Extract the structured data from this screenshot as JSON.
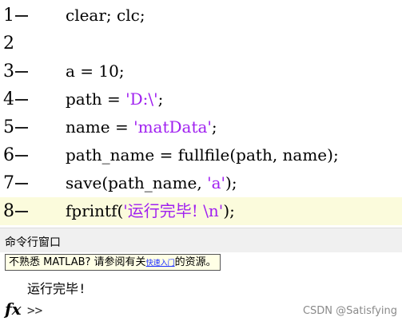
{
  "editor": {
    "lines": [
      {
        "number": "1",
        "code": "clear; clc;",
        "parts": [
          {
            "t": "clear; clc;",
            "s": false
          }
        ]
      },
      {
        "number": "2",
        "code": "",
        "parts": []
      },
      {
        "number": "3",
        "code": "a = 10;",
        "parts": [
          {
            "t": "a = 10;",
            "s": false
          }
        ]
      },
      {
        "number": "4",
        "code": "path = 'D:\\';",
        "parts": [
          {
            "t": "path = ",
            "s": false
          },
          {
            "t": "'D:\\'",
            "s": true
          },
          {
            "t": ";",
            "s": false
          }
        ]
      },
      {
        "number": "5",
        "code": "name = 'matData';",
        "parts": [
          {
            "t": "name = ",
            "s": false
          },
          {
            "t": "'matData'",
            "s": true
          },
          {
            "t": ";",
            "s": false
          }
        ]
      },
      {
        "number": "6",
        "code": "path_name = fullfile(path, name);",
        "parts": [
          {
            "t": "path_name = fullfile(path, name);",
            "s": false
          }
        ]
      },
      {
        "number": "7",
        "code": "save(path_name, 'a');",
        "parts": [
          {
            "t": "save(path_name, ",
            "s": false
          },
          {
            "t": "'a'",
            "s": true
          },
          {
            "t": ");",
            "s": false
          }
        ]
      },
      {
        "number": "8",
        "code": "fprintf('运行完毕! \\n');",
        "parts": [
          {
            "t": "fprintf(",
            "s": false
          },
          {
            "t": "'运行完毕! \\n'",
            "s": true
          },
          {
            "t": ");",
            "s": false
          }
        ],
        "highlighted": true
      }
    ]
  },
  "command_window": {
    "title": "命令行窗口",
    "info_prefix": "不熟悉 MATLAB? 请参阅有关",
    "info_link": "快速入门",
    "info_suffix": "的资源。",
    "output": "运行完毕!",
    "prompt": ">>",
    "fx_label": "fx"
  },
  "watermark": "CSDN @Satisfying",
  "colors": {
    "string": "#a020f0",
    "highlight": "#fbfbdc",
    "link": "#1a2dff"
  }
}
